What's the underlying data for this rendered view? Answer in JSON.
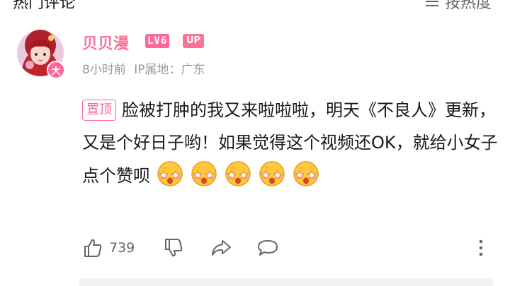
{
  "header": {
    "section_title": "热门评论",
    "sort_label": "按热度"
  },
  "comment": {
    "avatar_badge": "大",
    "username": "贝贝漫",
    "level": "LV6",
    "up_badge": "UP",
    "time": "8小时前",
    "ip_location": "IP属地：广东",
    "pinned_tag": "置顶",
    "text": "脸被打肿的我又来啦啦啦，明天《不良人》更新，又是个好日子哟！如果觉得这个视频还OK，就给小女子点个赞呗",
    "emoji_name": "star-eyes-emoji",
    "emoji_count": 5
  },
  "actions": {
    "like_count": "739"
  },
  "colors": {
    "accent": "#fb7299",
    "text": "#18191c",
    "muted": "#9499a0"
  }
}
